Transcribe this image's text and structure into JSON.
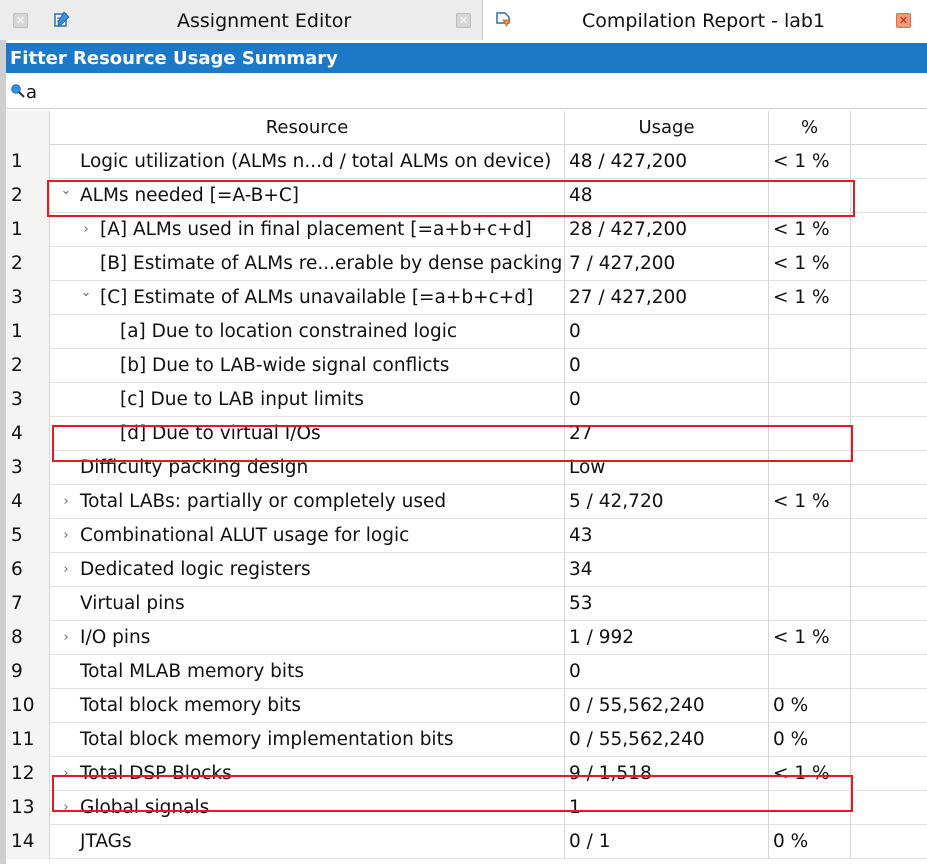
{
  "tabs": [
    {
      "label": "Assignment Editor",
      "icon": "assignment-editor-icon",
      "close_icon": "close-icon"
    },
    {
      "label": "Compilation Report - lab1",
      "icon": "compilation-report-icon",
      "close_icon": "close-icon"
    }
  ],
  "panel": {
    "title": "Fitter Resource Usage Summary",
    "filter_value": "a",
    "filter_icon": "search-icon"
  },
  "colors": {
    "title_bar": "#1e78c8",
    "highlight": "#e01b24"
  },
  "table": {
    "headers": {
      "number": "",
      "resource": "Resource",
      "usage": "Usage",
      "percent": "%"
    },
    "rows": [
      {
        "num": "1",
        "resource": "Logic utilization (ALMs n...d / total ALMs on device)",
        "usage": "48 / 427,200",
        "percent": "< 1 %",
        "level": 0,
        "expander": "none"
      },
      {
        "num": "2",
        "resource": "ALMs needed [=A-B+C]",
        "usage": "48",
        "percent": "",
        "level": 0,
        "expander": "expanded",
        "highlighted": true
      },
      {
        "num": "1",
        "resource": "[A] ALMs used in final placement [=a+b+c+d]",
        "usage": "28 / 427,200",
        "percent": "< 1 %",
        "level": 1,
        "expander": "collapsed"
      },
      {
        "num": "2",
        "resource": "[B] Estimate of ALMs re...erable by dense packing",
        "usage": "7 / 427,200",
        "percent": "< 1 %",
        "level": 1,
        "expander": "none"
      },
      {
        "num": "3",
        "resource": "[C] Estimate of ALMs unavailable [=a+b+c+d]",
        "usage": "27 / 427,200",
        "percent": "< 1 %",
        "level": 1,
        "expander": "expanded"
      },
      {
        "num": "1",
        "resource": "[a] Due to location constrained logic",
        "usage": "0",
        "percent": "",
        "level": 2,
        "expander": "none"
      },
      {
        "num": "2",
        "resource": "[b] Due to LAB-wide signal conflicts",
        "usage": "0",
        "percent": "",
        "level": 2,
        "expander": "none"
      },
      {
        "num": "3",
        "resource": "[c] Due to LAB input limits",
        "usage": "0",
        "percent": "",
        "level": 2,
        "expander": "none"
      },
      {
        "num": "4",
        "resource": "[d] Due to virtual I/Os",
        "usage": "27",
        "percent": "",
        "level": 2,
        "expander": "none",
        "highlighted": true
      },
      {
        "num": "3",
        "resource": "Difficulty packing design",
        "usage": "Low",
        "percent": "",
        "level": 0,
        "expander": "none"
      },
      {
        "num": "4",
        "resource": "Total LABs:  partially or completely used",
        "usage": "5 / 42,720",
        "percent": "< 1 %",
        "level": 0,
        "expander": "collapsed"
      },
      {
        "num": "5",
        "resource": "Combinational ALUT usage for logic",
        "usage": "43",
        "percent": "",
        "level": 0,
        "expander": "collapsed"
      },
      {
        "num": "6",
        "resource": "Dedicated logic registers",
        "usage": "34",
        "percent": "",
        "level": 0,
        "expander": "collapsed"
      },
      {
        "num": "7",
        "resource": "Virtual pins",
        "usage": "53",
        "percent": "",
        "level": 0,
        "expander": "none"
      },
      {
        "num": "8",
        "resource": "I/O pins",
        "usage": "1 / 992",
        "percent": "< 1 %",
        "level": 0,
        "expander": "collapsed"
      },
      {
        "num": "9",
        "resource": "Total MLAB memory bits",
        "usage": "0",
        "percent": "",
        "level": 0,
        "expander": "none"
      },
      {
        "num": "10",
        "resource": "Total block memory bits",
        "usage": "0 / 55,562,240",
        "percent": "0 %",
        "level": 0,
        "expander": "none"
      },
      {
        "num": "11",
        "resource": "Total block memory implementation bits",
        "usage": "0 / 55,562,240",
        "percent": "0 %",
        "level": 0,
        "expander": "none"
      },
      {
        "num": "12",
        "resource": "Total DSP Blocks",
        "usage": "9 / 1,518",
        "percent": "< 1 %",
        "level": 0,
        "expander": "collapsed",
        "highlighted": true
      },
      {
        "num": "13",
        "resource": "Global signals",
        "usage": "1",
        "percent": "",
        "level": 0,
        "expander": "collapsed"
      },
      {
        "num": "14",
        "resource": "JTAGs",
        "usage": "0 / 1",
        "percent": "0 %",
        "level": 0,
        "expander": "none"
      }
    ]
  }
}
